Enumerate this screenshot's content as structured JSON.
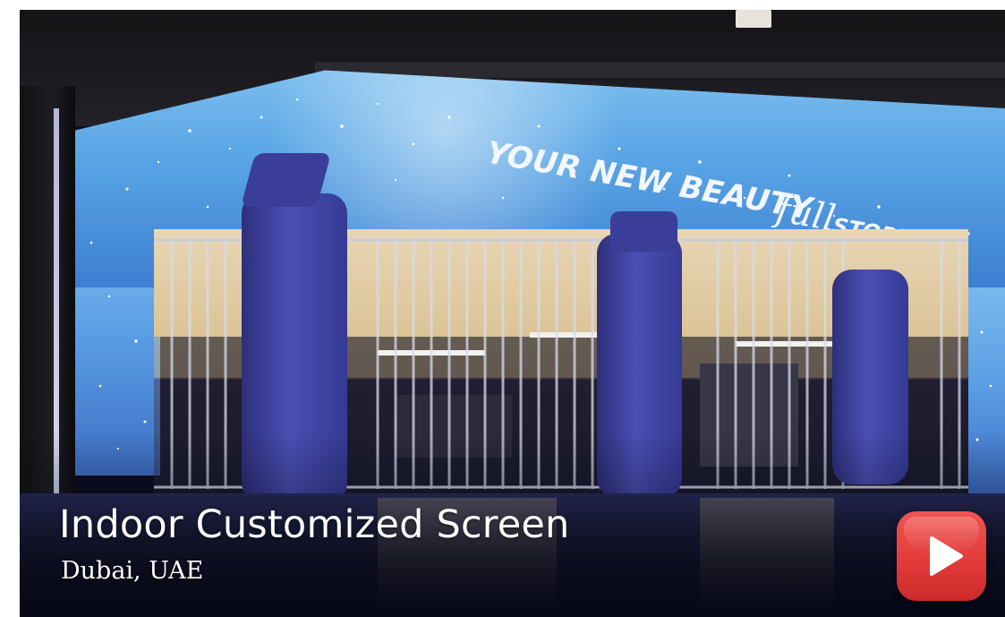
{
  "video_card": {
    "title": "Indoor Customized Screen",
    "location": "Dubai, UAE",
    "banner_text_main": "YOUR NEW BEAUTY",
    "banner_text_script": "full",
    "banner_text_end": "STORE",
    "play_icon": "play-icon"
  },
  "colors": {
    "play_button": "#e23b3a",
    "led_sky": "#5aa6e6",
    "pillar": "#3a3e98"
  }
}
